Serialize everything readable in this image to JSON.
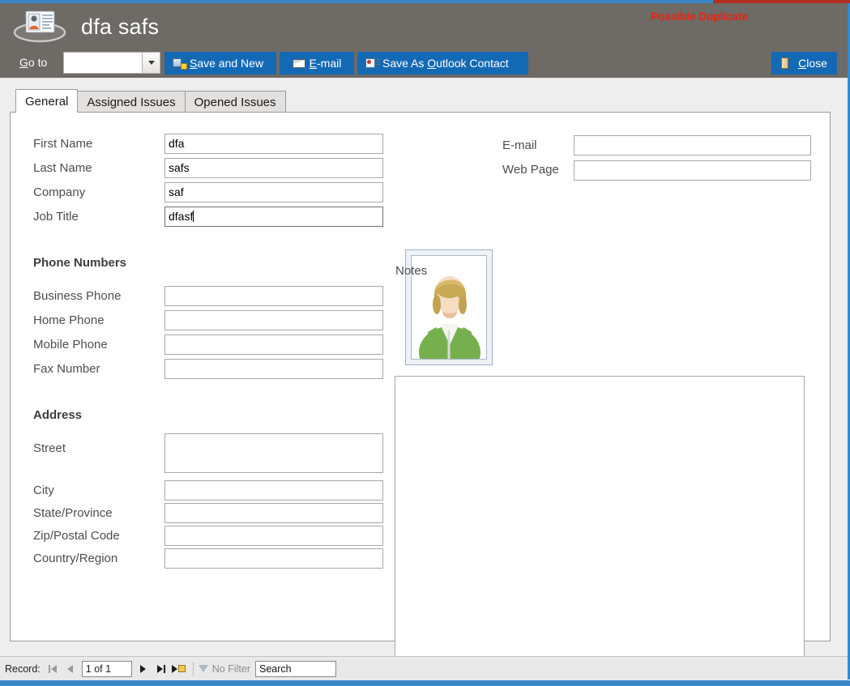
{
  "window": {
    "accent_blue": "#3a86c8",
    "header_bg": "#6e6a65",
    "button_blue": "#1469b5"
  },
  "header": {
    "app_icon": "contact-card-icon",
    "title": "dfa safs",
    "duplicate_warning": "Possible Duplicate",
    "duplicate_warning_color": "#ee2211",
    "goto": {
      "label_before": "G",
      "label_accel": "G",
      "label": "Go to",
      "value": "",
      "dropdown_icon": "chevron-down-icon"
    },
    "buttons": [
      {
        "id": "save-and-new",
        "label": "Save and New",
        "accel": "S",
        "icon": "save-new-icon"
      },
      {
        "id": "email",
        "label": "E-mail",
        "accel": "E",
        "icon": "envelope-icon"
      },
      {
        "id": "save-as-outlook-contact",
        "label": "Save As Outlook Contact",
        "accel": "O",
        "icon": "outlook-contact-icon"
      },
      {
        "id": "close",
        "label": "Close",
        "accel": "C",
        "icon": "close-door-icon"
      }
    ]
  },
  "tabs": [
    {
      "label": "General",
      "active": true
    },
    {
      "label": "Assigned Issues",
      "active": false
    },
    {
      "label": "Opened Issues",
      "active": false
    }
  ],
  "form": {
    "identity_fields": [
      {
        "label": "First Name",
        "value": "dfa",
        "focused": false
      },
      {
        "label": "Last Name",
        "value": "safs",
        "focused": false
      },
      {
        "label": "Company",
        "value": "saf",
        "focused": false
      },
      {
        "label": "Job Title",
        "value": "dfasf",
        "focused": true
      }
    ],
    "contact_fields": [
      {
        "label": "E-mail",
        "value": ""
      },
      {
        "label": "Web Page",
        "value": ""
      }
    ],
    "photo": {
      "alt": "contact-photo-placeholder"
    },
    "notes": {
      "label": "Notes",
      "value": ""
    },
    "phone_section": {
      "title": "Phone Numbers",
      "fields": [
        {
          "label": "Business Phone",
          "value": ""
        },
        {
          "label": "Home Phone",
          "value": ""
        },
        {
          "label": "Mobile Phone",
          "value": ""
        },
        {
          "label": "Fax Number",
          "value": ""
        }
      ]
    },
    "address_section": {
      "title": "Address",
      "fields": [
        {
          "label": "Street",
          "value": ""
        },
        {
          "label": "City",
          "value": ""
        },
        {
          "label": "State/Province",
          "value": ""
        },
        {
          "label": "Zip/Postal Code",
          "value": ""
        },
        {
          "label": "Country/Region",
          "value": ""
        }
      ]
    }
  },
  "navbar": {
    "record_label": "Record:",
    "current": "1 of 1",
    "first_icon": "first-record-icon",
    "previous_icon": "previous-record-icon",
    "next_icon": "next-record-icon",
    "last_icon": "last-record-icon",
    "new_icon": "new-record-icon",
    "filter_icon": "filter-icon",
    "filter_label": "No Filter",
    "search_value": "Search"
  }
}
